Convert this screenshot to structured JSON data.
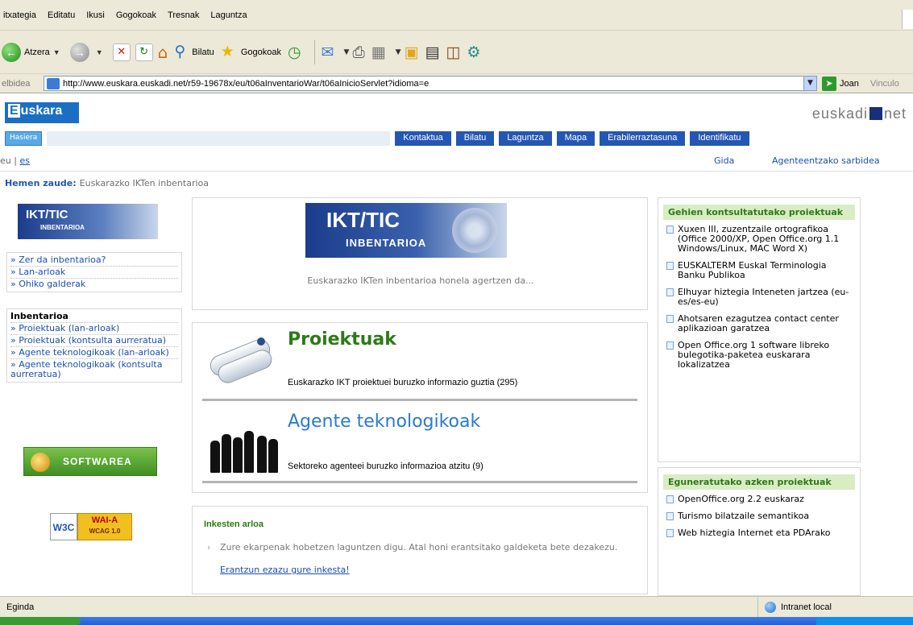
{
  "browser": {
    "menu": [
      "itxategia",
      "Editatu",
      "Ikusi",
      "Gogokoak",
      "Tresnak",
      "Laguntza"
    ],
    "toolbar": {
      "back_label": "Atzera",
      "search_label": "Bilatu",
      "favorites_label": "Gogokoak"
    },
    "address_label": "elbidea",
    "url": "http://www.euskara.euskadi.net/r59-19678x/eu/t06aInventarioWar/t06aInicioServlet?idioma=e",
    "go_label": "Joan",
    "links_label": "Vinculo",
    "status_left": "Eginda",
    "status_zone": "Intranet local"
  },
  "site": {
    "logo_first": "E",
    "logo_rest": "uskara",
    "brand_left": "euskadi",
    "brand_right": "net",
    "home_button": "Hasiera",
    "nav": [
      "Kontaktua",
      "Bilatu",
      "Laguntza",
      "Mapa",
      "Erabilerraztasuna",
      "Identifikatu"
    ],
    "lang_prefix": "eu | ",
    "lang_es": "es",
    "gida": "Gida",
    "agente_sarbidea": "Agenteentzako sarbidea",
    "breadcrumb_label": "Hemen zaude:",
    "breadcrumb_value": "Euskarazko IKTen inbentarioa"
  },
  "left": {
    "logo_title": "IKT/TIC",
    "logo_sub": "INBENTARIOA",
    "links": [
      "» Zer da inbentarioa?",
      "» Lan-arloak",
      "» Ohiko galderak"
    ],
    "inventory_heading": "Inbentarioa",
    "inventory_links": [
      "» Proiektuak (lan-arloak)",
      "» Proiektuak (kontsulta aurreratua)",
      "» Agente teknologikoak (lan-arloak)",
      "» Agente teknologikoak (kontsulta aurreratua)"
    ],
    "softwarea": "SOFTWAREA",
    "w3c_left": "W3C",
    "w3c_top": "WAI-A",
    "w3c_bottom": "WCAG 1.0"
  },
  "center": {
    "banner_title": "IKT/TIC",
    "banner_sub": "INBENTARIOA",
    "intro": "Euskarazko IKTen inbentarioa honela agertzen da...",
    "projects_title": "Proiektuak",
    "projects_desc": "Euskarazko IKT proiektuei buruzko informazio guztia (295)",
    "agents_title": "Agente teknologikoak",
    "agents_desc": "Sektoreko agenteei buruzko informazioa atzitu (9)",
    "survey_title": "Inkesten arloa",
    "survey_text": "Zure ekarpenak hobetzen laguntzen digu. Atal honi erantsitako galdeketa bete dezakezu.",
    "survey_link": "Erantzun ezazu gure inkesta!"
  },
  "right": {
    "most_consulted_title": "Gehien kontsultatutako proiektuak",
    "most_consulted": [
      "Xuxen III, zuzentzaile ortografikoa (Office 2000/XP, Open Office.org 1.1 Windows/Linux, MAC Word X)",
      "EUSKALTERM Euskal Terminologia Banku Publikoa",
      "Elhuyar hiztegia Inteneten jartzea (eu-es/es-eu)",
      "Ahotsaren ezagutzea contact center aplikazioan garatzea",
      "Open Office.org 1 software libreko bulegotika-paketea euskarara lokalizatzea"
    ],
    "recent_title": "Eguneratutako azken proiektuak",
    "recent": [
      "OpenOffice.org 2.2 euskaraz",
      "Turismo bilatzaile semantikoa",
      "Web hiztegia Internet eta PDArako"
    ]
  }
}
